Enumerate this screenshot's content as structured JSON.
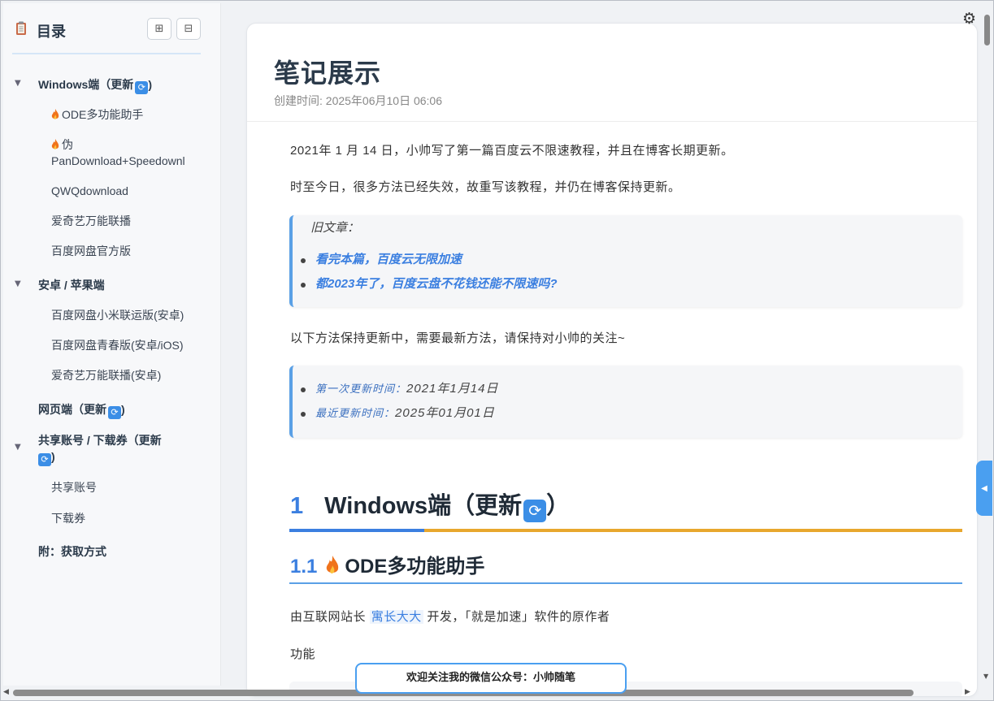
{
  "toc": {
    "title": "目录",
    "expand_icon": "⊞",
    "collapse_icon": "⊟",
    "items": [
      {
        "label": "Windows端（更新",
        "level": 1,
        "sync": true
      },
      {
        "label": "ODE多功能助手",
        "level": 2,
        "fire": true
      },
      {
        "label": "伪",
        "label2": "PanDownload+Speedownl",
        "level": 2,
        "fire": true
      },
      {
        "label": "QWQdownload",
        "level": 2
      },
      {
        "label": "爱奇艺万能联播",
        "level": 2
      },
      {
        "label": "百度网盘官方版",
        "level": 2
      },
      {
        "label": "安卓 / 苹果端",
        "level": 1
      },
      {
        "label": "百度网盘小米联运版(安卓)",
        "level": 2
      },
      {
        "label": "百度网盘青春版(安卓/iOS)",
        "level": 2
      },
      {
        "label": "爱奇艺万能联播(安卓)",
        "level": 2
      },
      {
        "label": "网页端（更新",
        "level": 1,
        "sync": true
      },
      {
        "label": "共享账号 / 下载券（更新",
        "level": 1,
        "sync": true
      },
      {
        "label": "共享账号",
        "level": 2
      },
      {
        "label": "下载券",
        "level": 2
      },
      {
        "label": "附：获取方式",
        "level": 1
      }
    ]
  },
  "article": {
    "title": "笔记展示",
    "created": "创建时间: 2025年06月10日 06:06",
    "p1": "2021年 1 月 14 日，小帅写了第一篇百度云不限速教程，并且在博客长期更新。",
    "p2": "时至今日，很多方法已经失效，故重写该教程，并仍在博客保持更新。",
    "old_label": "旧文章：",
    "old_links": [
      "看完本篇，百度云无限加速",
      "都2023年了，百度云盘不花钱还能不限速吗?"
    ],
    "p3": "以下方法保持更新中，需要最新方法，请保持对小帅的关注~",
    "first_update_label": "第一次更新时间：",
    "first_update_val": "2021年1月14日",
    "last_update_label": "最近更新时间：",
    "last_update_val": "2025年01月01日",
    "h1_num": "1",
    "h1_text": "Windows端（更新",
    "h1_tail": "）",
    "h2_num": "1.1",
    "h2_text": "ODE多功能助手",
    "p4_pre": "由互联网站长",
    "p4_link": "寓长大大",
    "p4_post": "开发，「就是加速」软件的原作者",
    "p5": "功能"
  },
  "ui": {
    "gear_icon": "⚙",
    "sync_icon": "⟳",
    "side_tab_icon": "◀",
    "banner": "欢迎关注我的微信公众号：小帅随笔",
    "accent": "#3b7fe0",
    "h1_underline": "#e8a72e"
  }
}
